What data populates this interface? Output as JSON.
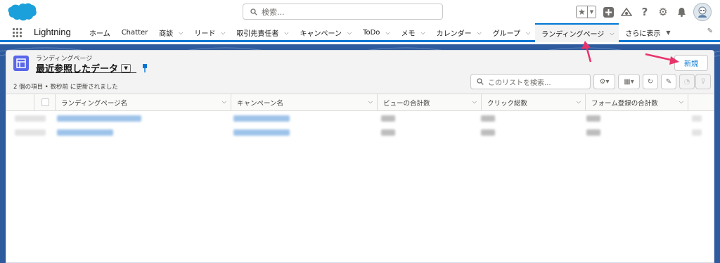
{
  "header": {
    "search_placeholder": "検索..."
  },
  "app": {
    "name": "Lightning"
  },
  "nav": {
    "items": [
      {
        "label": "ホーム",
        "has_menu": false
      },
      {
        "label": "Chatter",
        "has_menu": false
      },
      {
        "label": "商談",
        "has_menu": true
      },
      {
        "label": "リード",
        "has_menu": true
      },
      {
        "label": "取引先責任者",
        "has_menu": true
      },
      {
        "label": "キャンペーン",
        "has_menu": true
      },
      {
        "label": "ToDo",
        "has_menu": true
      },
      {
        "label": "メモ",
        "has_menu": true
      },
      {
        "label": "カレンダー",
        "has_menu": true
      },
      {
        "label": "グループ",
        "has_menu": true
      },
      {
        "label": "ランディングページ",
        "has_menu": true,
        "active": true
      },
      {
        "label": "さらに表示",
        "has_menu": true
      }
    ]
  },
  "list_view": {
    "object_label": "ランディングページ",
    "view_name": "最近参照したデータ",
    "new_button": "新規",
    "status": "2 個の項目 • 数秒前 に更新されました",
    "search_placeholder": "このリストを検索...",
    "columns": [
      "ランディングページ名",
      "キャンペーン名",
      "ビューの合計数",
      "クリック総数",
      "フォーム登録の合計数"
    ]
  },
  "colors": {
    "brand": "#0176d3",
    "page_background": "#2e5b9e",
    "object_icon": "#5867e8",
    "annotation_arrow": "#e8336b"
  }
}
